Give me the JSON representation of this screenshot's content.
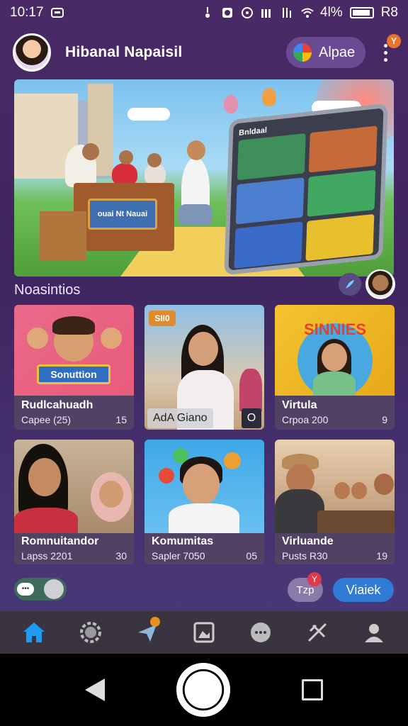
{
  "status_bar": {
    "time": "10:17",
    "battery_text": "4l%",
    "carrier_text": "R8"
  },
  "header": {
    "user_name": "Hibanal Napaisil",
    "app_pill_label": "Alpae",
    "notification_badge": "Y"
  },
  "hero": {
    "desk_sign_text": "ouai Nt Nauai",
    "tablet_title": "Bnldaal"
  },
  "section": {
    "title": "Noasintios"
  },
  "cards": [
    {
      "title": "Rudlcahuadh",
      "meta_left": "Capee (25)",
      "meta_right": "15",
      "banner": "Sonuttion"
    },
    {
      "title": "",
      "meta_left": "",
      "meta_right": "",
      "overlay_label": "AdA Giano",
      "overlay_num": "O",
      "tag": "SII0"
    },
    {
      "title": "Virtula",
      "meta_left": "Crpoa 200",
      "meta_right": "9",
      "banner": "SINNIES"
    },
    {
      "title": "Romnuitandor",
      "meta_left": "Lapss 2201",
      "meta_right": "30"
    },
    {
      "title": "Komumitas",
      "meta_left": "Sapler 7050",
      "meta_right": "05"
    },
    {
      "title": "Virluande",
      "meta_left": "Pusts R30",
      "meta_right": "19"
    }
  ],
  "controls": {
    "toggle_chat_text": "•••",
    "secondary_label": "Tzp",
    "secondary_badge": "Y",
    "primary_label": "Viaiek"
  },
  "bottom_nav": {
    "items": [
      "home-icon",
      "settings-icon",
      "send-icon",
      "gallery-icon",
      "chat-icon",
      "tools-icon",
      "profile-icon"
    ],
    "active": "home-icon",
    "accent": "#1e9bf0"
  }
}
